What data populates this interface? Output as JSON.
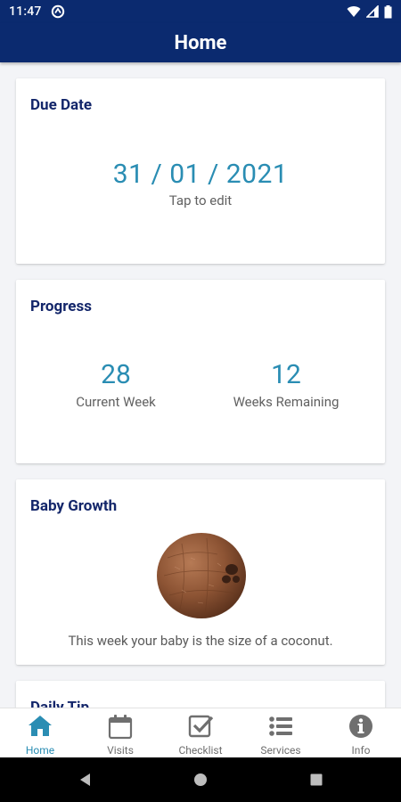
{
  "status_bar": {
    "time": "11:47",
    "icons": [
      "notification-icon",
      "wifi-icon",
      "signal-icon",
      "battery-icon"
    ]
  },
  "app_bar": {
    "title": "Home"
  },
  "cards": {
    "due_date": {
      "title": "Due Date",
      "date": "31 / 01 / 2021",
      "hint": "Tap to edit"
    },
    "progress": {
      "title": "Progress",
      "current_week_value": "28",
      "current_week_label": "Current Week",
      "weeks_remaining_value": "12",
      "weeks_remaining_label": "Weeks Remaining"
    },
    "baby_growth": {
      "title": "Baby Growth",
      "image": "coconut",
      "caption": "This week your baby is the size of a coconut."
    },
    "daily_tip": {
      "title": "Daily Tip"
    }
  },
  "bottom_nav": {
    "items": [
      {
        "label": "Home",
        "icon": "home-icon",
        "active": true
      },
      {
        "label": "Visits",
        "icon": "calendar-icon",
        "active": false
      },
      {
        "label": "Checklist",
        "icon": "checklist-icon",
        "active": false
      },
      {
        "label": "Services",
        "icon": "list-icon",
        "active": false
      },
      {
        "label": "Info",
        "icon": "info-icon",
        "active": false
      }
    ]
  },
  "colors": {
    "primary": "#0b2a6f",
    "accent": "#2a8db3",
    "card_title": "#13266a",
    "background": "#f3f4f7"
  }
}
